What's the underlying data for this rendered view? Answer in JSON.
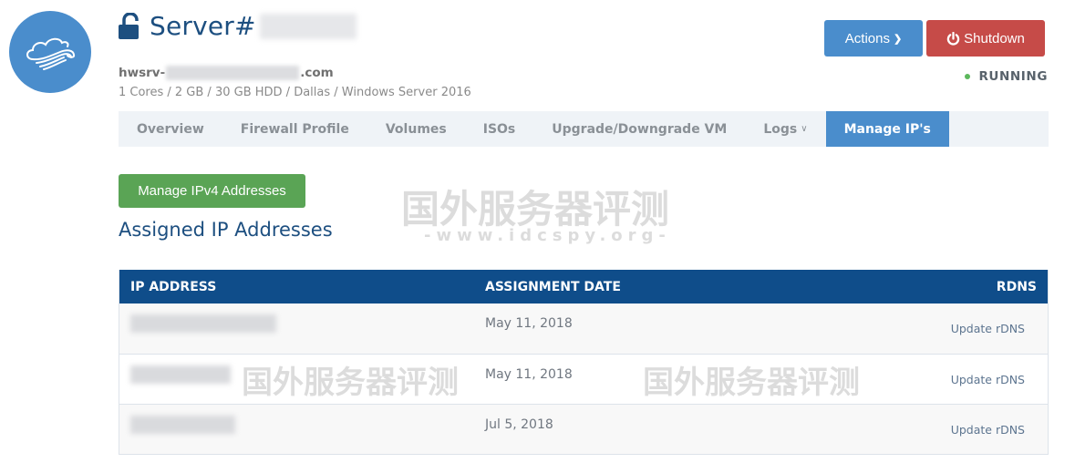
{
  "header": {
    "logo_icon": "cloud-wind-icon",
    "lock_icon": "unlocked-padlock-icon",
    "title_prefix": "Server#",
    "hostname_prefix": "hwsrv-",
    "hostname_suffix": ".com",
    "specs": "1 Cores / 2 GB / 30 GB HDD / Dallas / Windows Server 2016"
  },
  "actions": {
    "actions_label": "Actions",
    "shutdown_label": "Shutdown",
    "status": "RUNNING",
    "colors": {
      "actions": "#4a8dcc",
      "shutdown": "#c64b48",
      "status_dot": "#5cb85c"
    }
  },
  "tabs": [
    {
      "label": "Overview",
      "active": false
    },
    {
      "label": "Firewall Profile",
      "active": false
    },
    {
      "label": "Volumes",
      "active": false
    },
    {
      "label": "ISOs",
      "active": false
    },
    {
      "label": "Upgrade/Downgrade VM",
      "active": false
    },
    {
      "label": "Logs",
      "active": false,
      "dropdown": true
    },
    {
      "label": "Manage IP's",
      "active": true
    }
  ],
  "main": {
    "manage_button": "Manage IPv4 Addresses",
    "section_title": "Assigned IP Addresses",
    "table": {
      "columns": [
        "IP ADDRESS",
        "ASSIGNMENT DATE",
        "RDNS"
      ],
      "rows": [
        {
          "ip": "",
          "date": "May 11, 2018",
          "action": "Update rDNS"
        },
        {
          "ip": "",
          "date": "May 11, 2018",
          "action": "Update rDNS"
        },
        {
          "ip": "",
          "date": "Jul 5, 2018",
          "action": "Update rDNS"
        }
      ]
    }
  },
  "watermark": {
    "text": "国外服务器评测",
    "url": "-www.idcspy.org-"
  }
}
